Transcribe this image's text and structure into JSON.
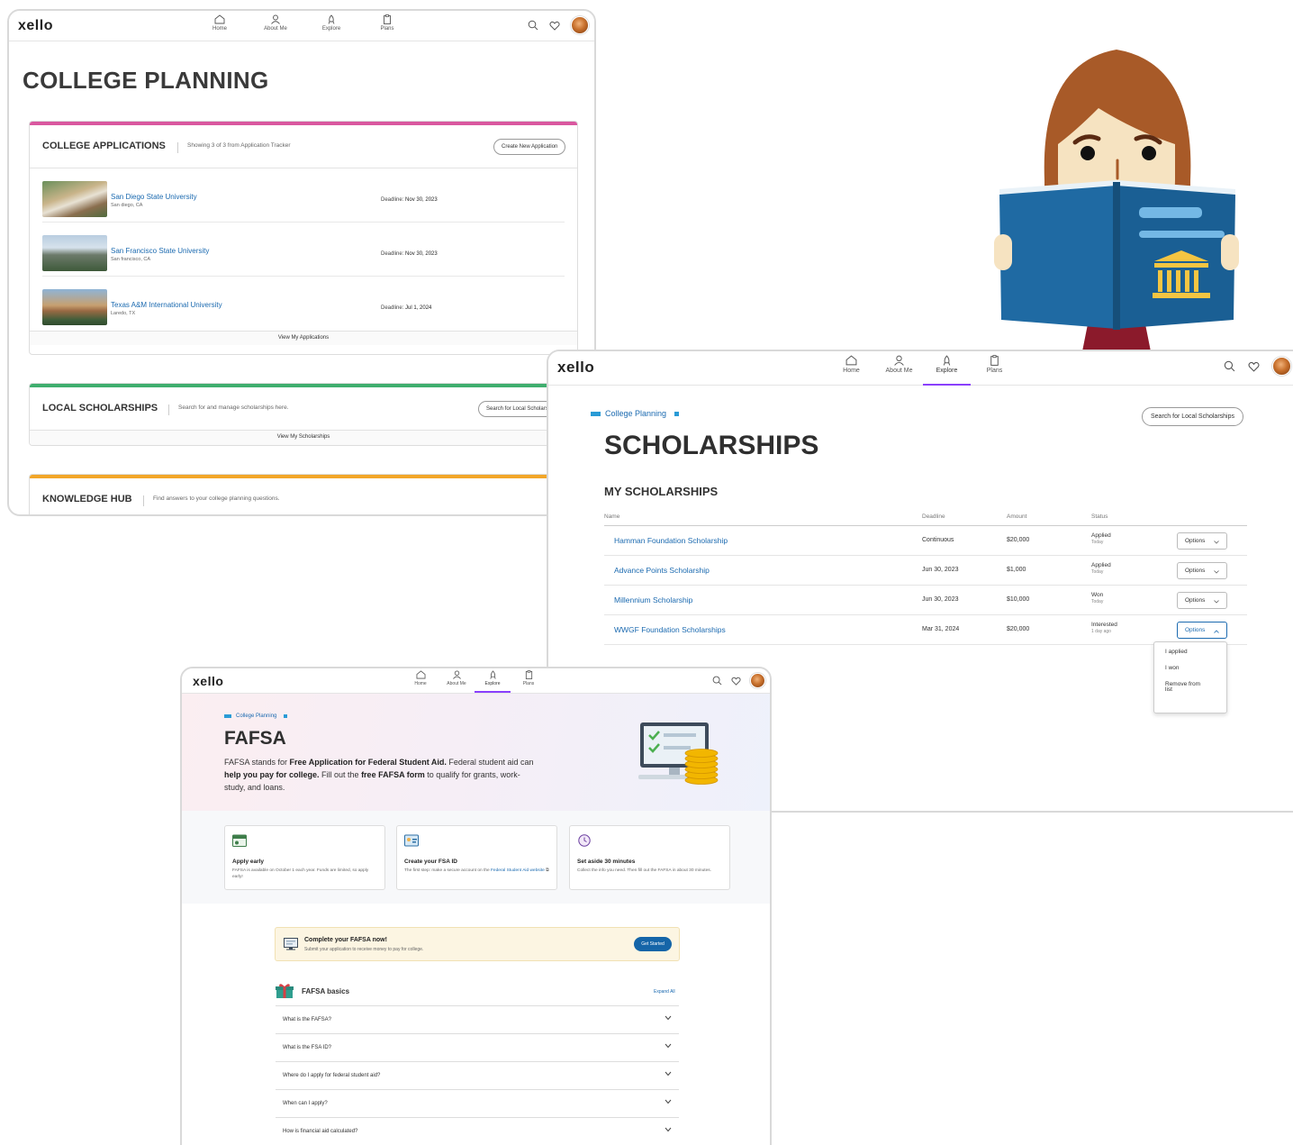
{
  "nav": {
    "logo": "xello",
    "items": [
      "Home",
      "About Me",
      "Explore",
      "Plans"
    ]
  },
  "college_planning": {
    "title": "COLLEGE PLANNING",
    "applications": {
      "title": "COLLEGE APPLICATIONS",
      "subtitle": "Showing 3 of 3 from Application Tracker",
      "button": "Create New Application",
      "items": [
        {
          "name": "San Diego State University",
          "location": "San diego, CA",
          "deadline_label": "Deadline:",
          "deadline": "Nov 30, 2023"
        },
        {
          "name": "San Francisco State University",
          "location": "San francisco, CA",
          "deadline_label": "Deadline:",
          "deadline": "Nov 30, 2023"
        },
        {
          "name": "Texas A&M International University",
          "location": "Laredo, TX",
          "deadline_label": "Deadline:",
          "deadline": "Jul 1, 2024"
        }
      ],
      "view_all": "View My Applications"
    },
    "local_scholarships": {
      "title": "LOCAL SCHOLARSHIPS",
      "subtitle": "Search for and manage scholarships here.",
      "button": "Search for Local Scholars",
      "view_all": "View My Scholarships"
    },
    "knowledge_hub": {
      "title": "KNOWLEDGE HUB",
      "subtitle": "Find answers to your college planning questions."
    },
    "colors": {
      "applications": "#d9579f",
      "scholarships": "#3fae6e",
      "knowledge": "#f2a629"
    }
  },
  "scholarships": {
    "breadcrumb": "College Planning",
    "search_button": "Search for Local Scholarships",
    "title": "SCHOLARSHIPS",
    "section": "MY SCHOLARSHIPS",
    "columns": [
      "Name",
      "Deadline",
      "Amount",
      "Status"
    ],
    "rows": [
      {
        "name": "Hamman Foundation Scholarship",
        "deadline": "Continuous",
        "amount": "$20,000",
        "status": "Applied",
        "when": "Today",
        "options": "Options"
      },
      {
        "name": "Advance Points Scholarship",
        "deadline": "Jun 30, 2023",
        "amount": "$1,000",
        "status": "Applied",
        "when": "Today",
        "options": "Options"
      },
      {
        "name": "Millennium Scholarship",
        "deadline": "Jun 30, 2023",
        "amount": "$10,000",
        "status": "Won",
        "when": "Today",
        "options": "Options"
      },
      {
        "name": "WWGF Foundation Scholarships",
        "deadline": "Mar 31, 2024",
        "amount": "$20,000",
        "status": "Interested",
        "when": "1 day ago",
        "options": "Options"
      }
    ],
    "menu": [
      "I applied",
      "I won",
      "Remove from list"
    ]
  },
  "fafsa": {
    "breadcrumb": "College Planning",
    "title": "FAFSA",
    "intro_parts": [
      {
        "t": "FAFSA stands for ",
        "b": false
      },
      {
        "t": "Free Application for Federal Student Aid.",
        "b": true
      },
      {
        "t": " Federal student aid can ",
        "b": false
      },
      {
        "t": "help you pay for college.",
        "b": true
      },
      {
        "t": " Fill out the ",
        "b": false
      },
      {
        "t": "free FAFSA form",
        "b": true
      },
      {
        "t": " to qualify for grants, work-study, and loans.",
        "b": false
      }
    ],
    "steps": [
      {
        "title": "Apply early",
        "desc": "FAFSA is available on October 1 each year. Funds are limited, so apply early!"
      },
      {
        "title": "Create your FSA ID",
        "desc": "The first step: make a secure account on the ",
        "link": "Federal Student Aid website"
      },
      {
        "title": "Set aside 30 minutes",
        "desc": "Collect the info you need. Then fill out the FAFSA in about 30 minutes."
      }
    ],
    "cta": {
      "title": "Complete your FAFSA now!",
      "subtitle": "Submit your application to receive money to pay for college.",
      "button": "Get Started"
    },
    "basics": {
      "title": "FAFSA basics",
      "expand": "Expand All",
      "questions": [
        "What is the FAFSA?",
        "What is the FSA ID?",
        "Where do I apply for federal student aid?",
        "When can I apply?",
        "How is financial aid calculated?"
      ]
    }
  }
}
